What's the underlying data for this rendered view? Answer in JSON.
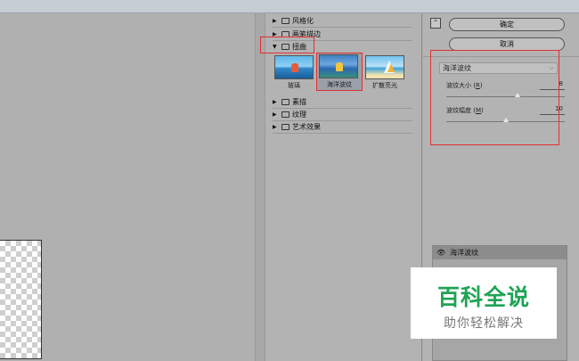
{
  "gallery": {
    "folders_top": [
      {
        "label": "风格化",
        "expanded": false
      },
      {
        "label": "画笔描边",
        "expanded": false
      },
      {
        "label": "扭曲",
        "expanded": true
      }
    ],
    "thumbnails": [
      {
        "label": "玻璃",
        "selected": false
      },
      {
        "label": "海洋波纹",
        "selected": true
      },
      {
        "label": "扩散亮光",
        "selected": false
      }
    ],
    "folders_bottom": [
      {
        "label": "素描",
        "expanded": false
      },
      {
        "label": "纹理",
        "expanded": false
      },
      {
        "label": "艺术效果",
        "expanded": false
      }
    ]
  },
  "settings": {
    "collapse_icon": "collapse-up-icon",
    "ok_label": "确定",
    "cancel_label": "取消",
    "filter_select": "海洋波纹",
    "params": [
      {
        "label": "波纹大小 (",
        "hotkey": "R",
        "value": "8",
        "fraction": 0.6
      },
      {
        "label": "波纹幅度 (",
        "hotkey": "M",
        "value": "10",
        "fraction": 0.5
      }
    ]
  },
  "layers": {
    "rows": [
      {
        "label": "海洋波纹",
        "icon": "eye-icon"
      }
    ]
  },
  "watermark": {
    "main": "百科全说",
    "sub": "助你轻松解决"
  },
  "colors": {
    "highlight": "#e03030",
    "watermark_green": "#1fa354"
  }
}
